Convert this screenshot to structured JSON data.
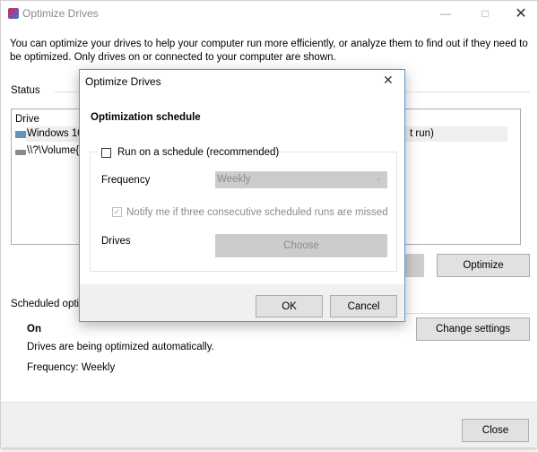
{
  "main": {
    "title": "Optimize Drives",
    "description_line1": "You can optimize your drives to help your computer run more efficiently, or analyze them to find out if they need to",
    "description_line2": "be optimized. Only drives on or connected to your computer are shown.",
    "status_label": "Status",
    "column_drive": "Drive",
    "drives": [
      {
        "name": "Windows 10",
        "icon": "hdd-windows-icon"
      },
      {
        "name": "\\\\?\\Volume{6",
        "icon": "hdd-icon"
      }
    ],
    "row1_trailing": "t run)",
    "optimize_label": "Optimize",
    "scheduled_label": "Scheduled optim",
    "schedule_state": "On",
    "schedule_desc": "Drives are being optimized automatically.",
    "schedule_freq": "Frequency: Weekly",
    "change_settings_label": "Change settings",
    "close_label": "Close",
    "colors": {
      "accent_border": "#5b9bd5",
      "selection": "#efefef"
    }
  },
  "dialog": {
    "title": "Optimize Drives",
    "heading": "Optimization schedule",
    "run_schedule_label": "Run on a schedule (recommended)",
    "run_schedule_checked": false,
    "frequency_label": "Frequency",
    "frequency_value": "Weekly",
    "notify_label": "Notify me if three consecutive scheduled runs are missed",
    "notify_checked": true,
    "drives_label": "Drives",
    "choose_label": "Choose",
    "ok_label": "OK",
    "cancel_label": "Cancel"
  }
}
